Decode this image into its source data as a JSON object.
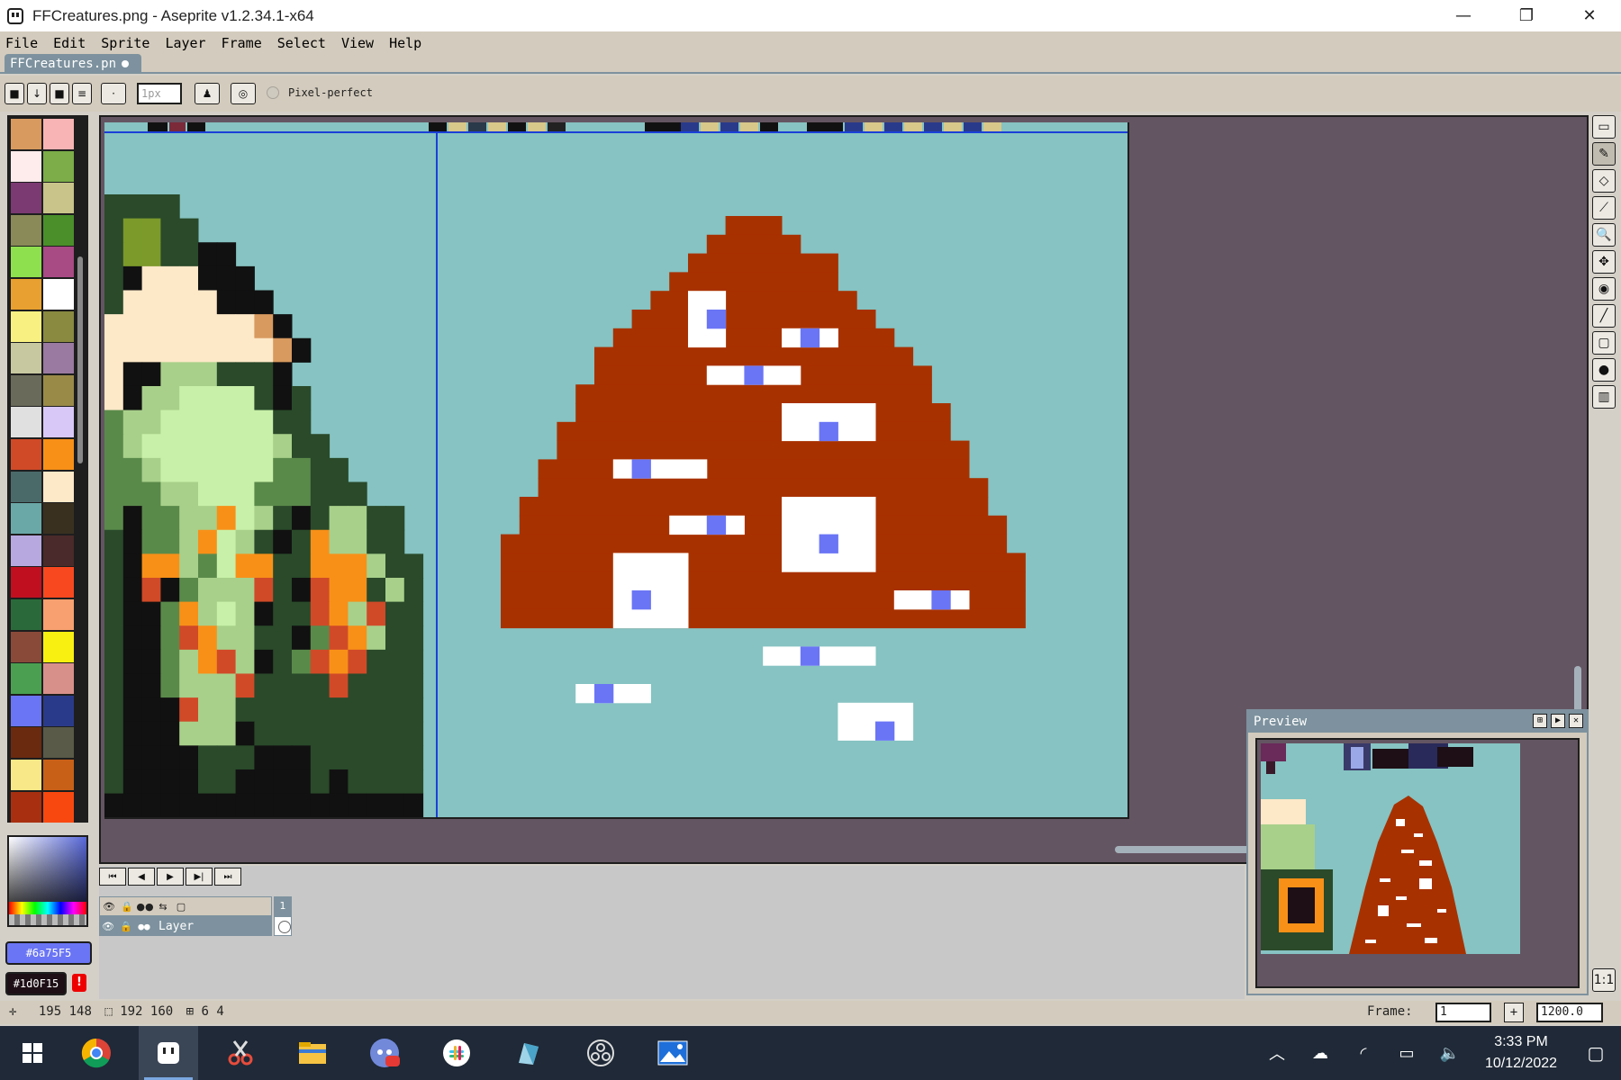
{
  "window": {
    "title": "FFCreatures.png - Aseprite v1.2.34.1-x64",
    "minimize": "—",
    "restore": "❐",
    "close": "✕"
  },
  "menu": [
    "File",
    "Edit",
    "Sprite",
    "Layer",
    "Frame",
    "Select",
    "View",
    "Help"
  ],
  "tab": {
    "label": "FFCreatures.pn"
  },
  "context": {
    "brush_size": "1px",
    "pixel_perfect_label": "Pixel-perfect"
  },
  "palette": [
    "#d89a5f",
    "#f8b4b4",
    "#fdeceb",
    "#7cad48",
    "#7b3a72",
    "#c8c48a",
    "#8a8a58",
    "#4a8f2a",
    "#8fe04e",
    "#a84a84",
    "#e8a030",
    "#ffffff",
    "#f8f080",
    "#8a8a40",
    "#c8c8a0",
    "#9a7aa0",
    "#6a6a5a",
    "#9a8a48",
    "#e0e0e0",
    "#d8c8f8",
    "#d04a28",
    "#f89018",
    "#4a6a6a",
    "#fde8c8",
    "#6aa8a8",
    "#3a3020",
    "#b8a8e0",
    "#4a2a2a",
    "#c01020",
    "#f84820",
    "#2a6a3a",
    "#f8a070",
    "#8a4a3a",
    "#f8f010",
    "#4aa050",
    "#d8908a",
    "#6a75f5",
    "#2a3a8a",
    "#6a2a10",
    "#5a5a48",
    "#f8e888",
    "#c86018",
    "#a83010",
    "#f84810"
  ],
  "colors": {
    "fg": "#6a75f5",
    "bg": "#1d0f15",
    "fg_label": "#6a75F5",
    "bg_label": "#1d0F15",
    "canvas_bg": "#86c3c2",
    "mountain": "#a83100",
    "snow": "#ffffff",
    "snow_accent": "#6a75f5"
  },
  "warn": "!",
  "tools": [
    "▭",
    "✎",
    "◇",
    "⟋",
    "🔍",
    "✥",
    "◉",
    "╱",
    "▢",
    "●",
    "▥"
  ],
  "timeline": {
    "buttons": [
      "⏮",
      "◀",
      "▶",
      "▶|",
      "⏭"
    ],
    "frame_number": "1",
    "layer_name": "Layer"
  },
  "preview": {
    "title": "Preview"
  },
  "status": {
    "position": "195 148",
    "size": "192 160",
    "grid": "6 4",
    "frame_label": "Frame:",
    "frame_value": "1",
    "plus": "+",
    "zoom": "1200.0"
  },
  "taskbar": {
    "time": "3:33 PM",
    "date": "10/12/2022"
  }
}
